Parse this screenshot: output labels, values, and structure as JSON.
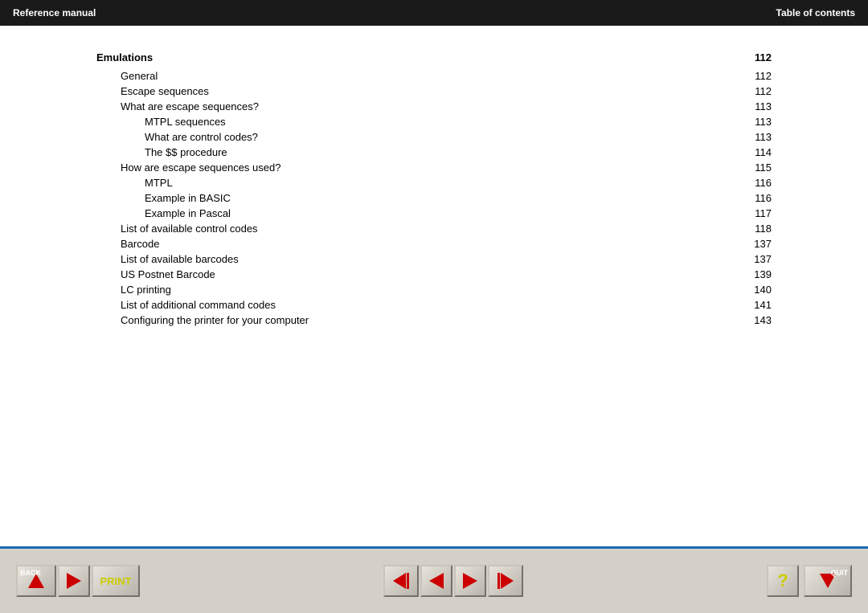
{
  "header": {
    "left_label": "Reference manual",
    "right_label": "Table of contents"
  },
  "toc": {
    "title": "Emulations",
    "title_num": "112",
    "items": [
      {
        "label": "General",
        "indent": 1,
        "num": "112"
      },
      {
        "label": "Escape sequences",
        "indent": 1,
        "num": "112"
      },
      {
        "label": "What are escape sequences?",
        "indent": 1,
        "num": "113"
      },
      {
        "label": "MTPL sequences",
        "indent": 2,
        "num": "113"
      },
      {
        "label": "What are control codes?",
        "indent": 2,
        "num": "113"
      },
      {
        "label": "The $$ procedure",
        "indent": 2,
        "num": "114"
      },
      {
        "label": "How are escape sequences used?",
        "indent": 1,
        "num": "115"
      },
      {
        "label": "MTPL",
        "indent": 2,
        "num": "116"
      },
      {
        "label": "Example in BASIC",
        "indent": 2,
        "num": "116"
      },
      {
        "label": "Example in Pascal",
        "indent": 2,
        "num": "117"
      },
      {
        "label": "List of available control codes",
        "indent": 1,
        "num": "118"
      },
      {
        "label": "Barcode",
        "indent": 1,
        "num": "137"
      },
      {
        "label": "List of available barcodes",
        "indent": 1,
        "num": "137"
      },
      {
        "label": "US Postnet Barcode",
        "indent": 1,
        "num": "139"
      },
      {
        "label": "LC printing",
        "indent": 1,
        "num": "140"
      },
      {
        "label": "List of additional command codes",
        "indent": 1,
        "num": "141"
      },
      {
        "label": "Configuring the printer for your computer",
        "indent": 1,
        "num": "143"
      }
    ]
  },
  "toolbar": {
    "back_label": "BACK",
    "print_label": "PRINT",
    "quit_label": "QUIT",
    "question_label": "?"
  }
}
